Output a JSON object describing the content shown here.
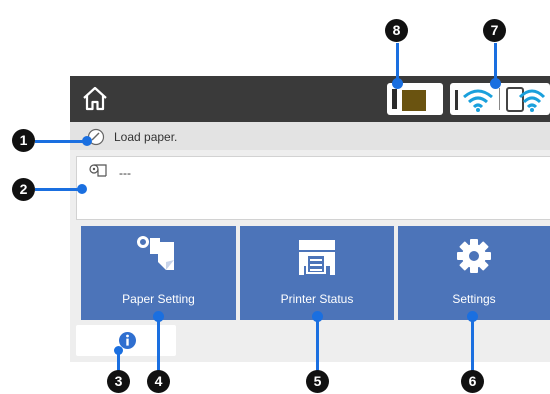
{
  "colors": {
    "topbar": "#3a3a3a",
    "panel": "#eeeeee",
    "tile": "#4c74b9",
    "callout_line": "#1a6fe0",
    "callout_dot": "#1a6fe0",
    "marker": "#111111",
    "ink": "#6a5310"
  },
  "icons": {
    "home": "home-icon",
    "ink": "ink-tank-icon",
    "wireless": "wifi-icon",
    "wifi_direct": "wifi-direct-icon",
    "status": "paper-loading-icon",
    "roll": "roll-paper-icon",
    "paper_setting": "paper-setting-icon",
    "printer_status": "printer-icon",
    "settings": "gear-icon",
    "info": "info-icon"
  },
  "status": {
    "message": "Load paper."
  },
  "paper_source": {
    "value": "---"
  },
  "tiles": [
    {
      "label": "Paper Setting"
    },
    {
      "label": "Printer Status"
    },
    {
      "label": "Settings"
    }
  ],
  "callouts": [
    {
      "number": "1"
    },
    {
      "number": "2"
    },
    {
      "number": "3"
    },
    {
      "number": "4"
    },
    {
      "number": "5"
    },
    {
      "number": "6"
    },
    {
      "number": "7"
    },
    {
      "number": "8"
    }
  ]
}
